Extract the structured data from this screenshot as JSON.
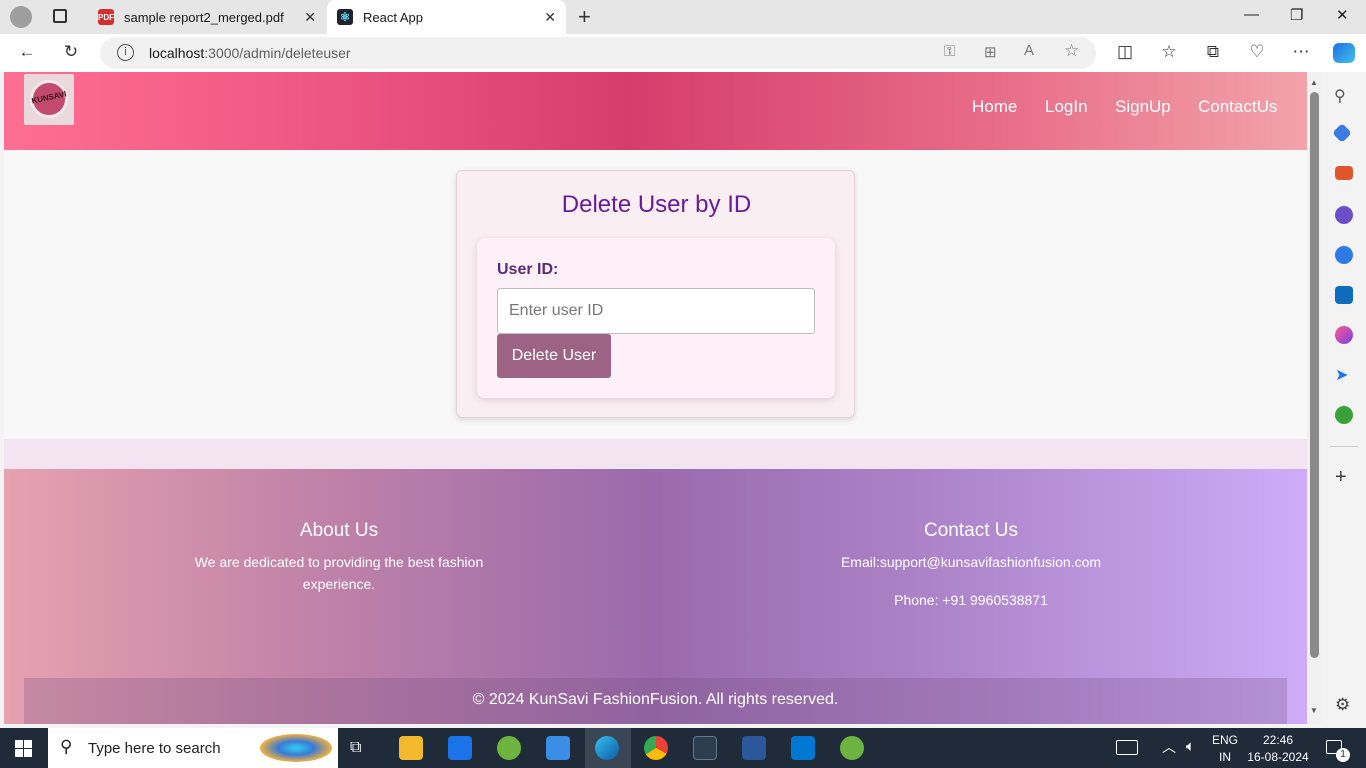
{
  "browser": {
    "tabs": [
      {
        "title": "sample report2_merged.pdf",
        "icon": "pdf-icon",
        "active": false
      },
      {
        "title": "React App",
        "icon": "react-icon",
        "active": true
      }
    ],
    "url_host": "localhost",
    "url_path": ":3000/admin/deleteuser"
  },
  "site": {
    "nav": {
      "links": [
        "Home",
        "LogIn",
        "SignUp",
        "ContactUs"
      ],
      "logo_text": "KUNSAVI"
    },
    "delete_form": {
      "title": "Delete User by ID",
      "field_label": "User ID:",
      "placeholder": "Enter user ID",
      "button_label": "Delete User"
    },
    "footer": {
      "about_title": "About Us",
      "about_text_line1": "We are dedicated to providing the best fashion",
      "about_text_line2": "experience.",
      "contact_title": "Contact Us",
      "email_text": "Email:support@kunsavifashionfusion.com",
      "phone_text": "Phone: +91 9960538871",
      "copyright": "© 2024 KunSavi FashionFusion. All rights reserved."
    }
  },
  "taskbar": {
    "search_placeholder": "Type here to search",
    "lang_line1": "ENG",
    "lang_line2": "IN",
    "time": "22:46",
    "date": "16-08-2024",
    "notification_count": "1"
  },
  "colors": {
    "accent_title": "#6a1b9a",
    "button": "#9c6385",
    "nav_gradient_mid": "#d63d6c"
  }
}
